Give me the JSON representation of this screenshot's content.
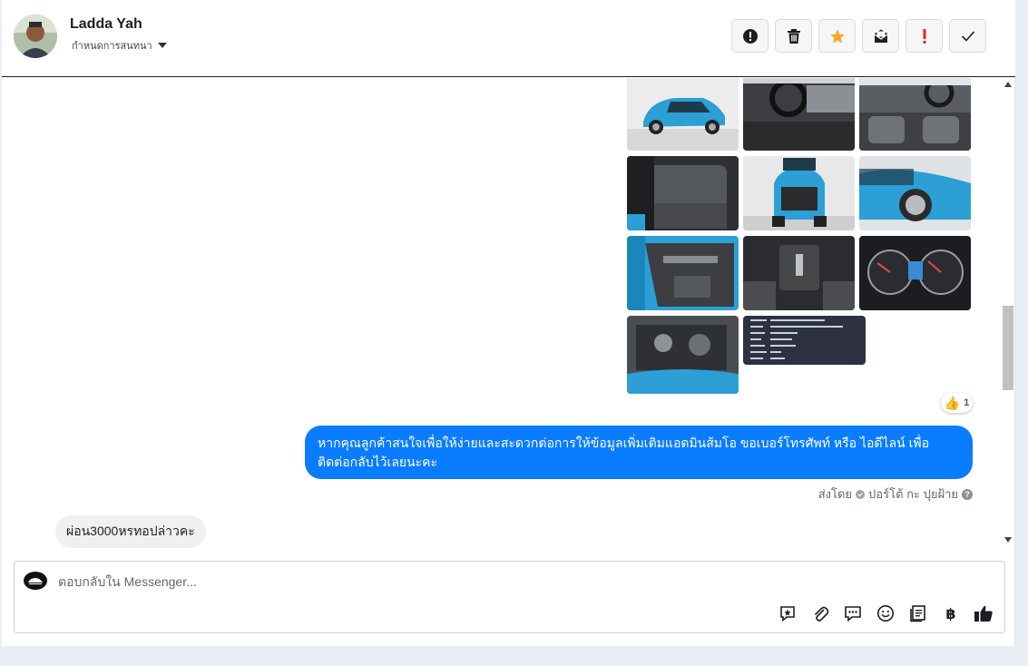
{
  "header": {
    "contact_name": "Ladda Yah",
    "assign_label": "กำหนดการสนทนา",
    "actions": [
      {
        "name": "mark-spam-button",
        "icon": "alert-circle-icon"
      },
      {
        "name": "delete-button",
        "icon": "trash-icon"
      },
      {
        "name": "star-button",
        "icon": "star-icon"
      },
      {
        "name": "mark-unread-button",
        "icon": "envelope-icon"
      },
      {
        "name": "important-button",
        "icon": "exclamation-icon"
      },
      {
        "name": "mark-done-button",
        "icon": "checkmark-icon"
      }
    ]
  },
  "thread": {
    "photo_count": 10,
    "reaction": {
      "icon": "thumbs-up-icon",
      "count": "1"
    },
    "outgoing_message": "หากคุณลูกค้าสนใจเพื่อให้ง่ายและสะดวกต่อการให้ข้อมูลเพิ่มเติมแอดมินส้มโอ ขอเบอร์โทรศัพท์ หรือ ไอดีไลน์ เพื่อติดต่อกลับไว้เลยนะคะ",
    "sent_by_label": "ส่งโดย",
    "sent_by_name": "ปอร์โต้ กะ ปุยฝ้าย",
    "incoming_message": "ผ่อน3000หรทอปล่าวคะ"
  },
  "composer": {
    "placeholder": "ตอบกลับใน Messenger...",
    "tools": [
      "quick-reply-icon",
      "attachment-icon",
      "saved-replies-icon",
      "emoji-icon",
      "catalog-icon",
      "payment-icon",
      "like-icon"
    ],
    "payment_symbol": "฿"
  },
  "colors": {
    "accent": "#0a7cff",
    "star": "#f5a623",
    "important": "#e4262b",
    "car_blue": "#2c9fd6"
  }
}
